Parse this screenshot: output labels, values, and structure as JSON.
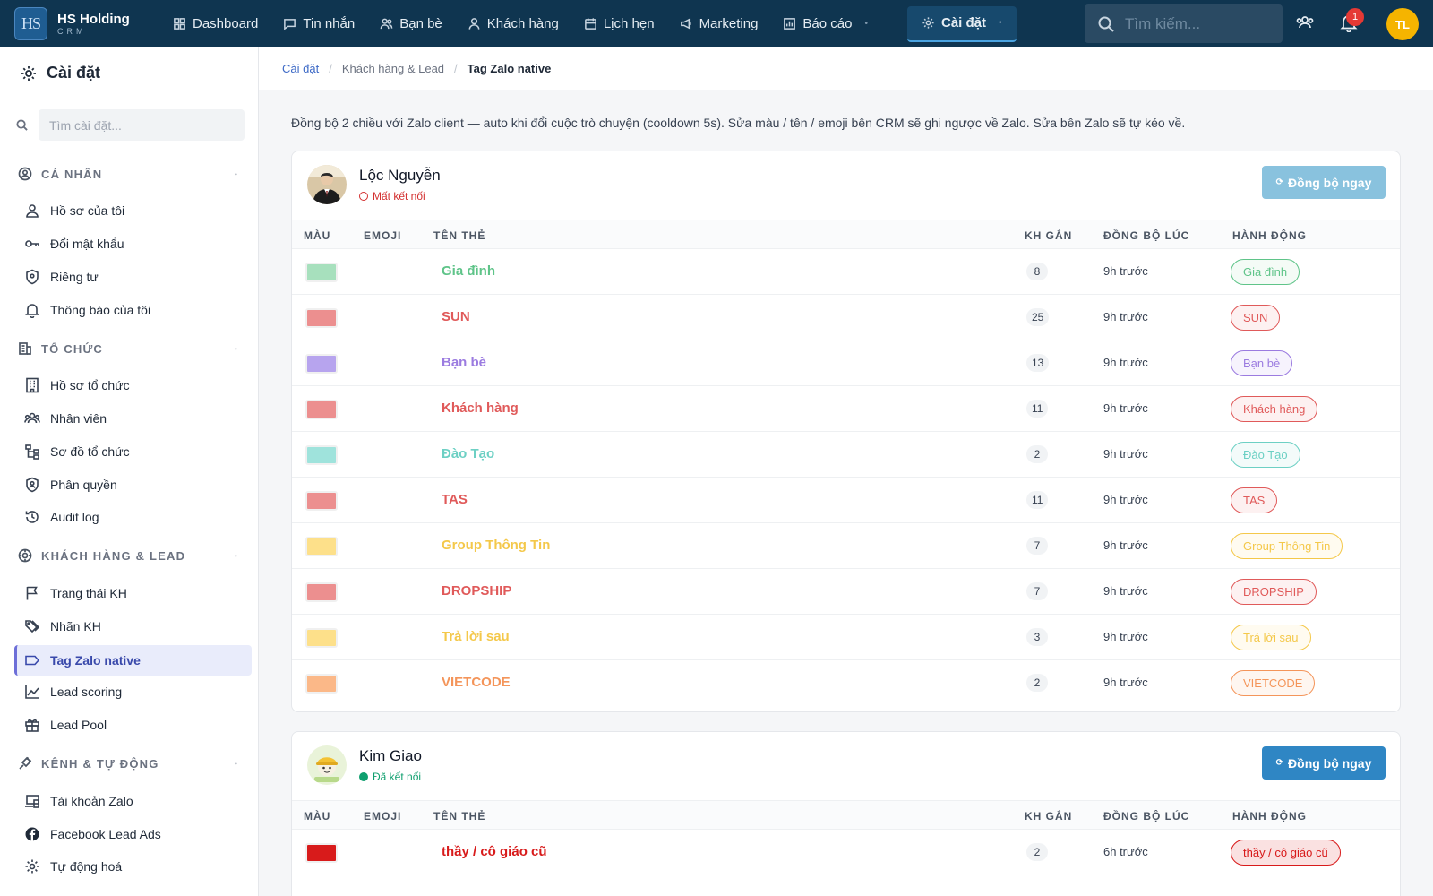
{
  "brand": {
    "logo": "HS",
    "title": "HS Holding",
    "subtitle": "CRM"
  },
  "nav": [
    {
      "label": "Dashboard",
      "icon": "grid-icon"
    },
    {
      "label": "Tin nhắn",
      "icon": "chat-icon"
    },
    {
      "label": "Bạn bè",
      "icon": "users-icon"
    },
    {
      "label": "Khách hàng",
      "icon": "user-icon"
    },
    {
      "label": "Lịch hẹn",
      "icon": "calendar-icon"
    },
    {
      "label": "Marketing",
      "icon": "megaphone-icon"
    },
    {
      "label": "Báo cáo",
      "icon": "chart-icon"
    },
    {
      "label": "Cài đặt",
      "icon": "gear-icon"
    }
  ],
  "topbar": {
    "search_placeholder": "Tìm kiếm...",
    "notification_count": "1",
    "avatar_initials": "TL"
  },
  "sidebar": {
    "title": "Cài đặt",
    "search_placeholder": "Tìm cài đặt...",
    "sections": [
      {
        "label": "CÁ NHÂN",
        "icon": "user-circle-icon",
        "items": [
          {
            "label": "Hồ sơ của tôi",
            "icon": "person-icon"
          },
          {
            "label": "Đổi mật khẩu",
            "icon": "key-icon"
          },
          {
            "label": "Riêng tư",
            "icon": "shield-icon"
          },
          {
            "label": "Thông báo của tôi",
            "icon": "bell-icon"
          }
        ]
      },
      {
        "label": "TỔ CHỨC",
        "icon": "building-icon",
        "items": [
          {
            "label": "Hồ sơ tổ chức",
            "icon": "office-icon"
          },
          {
            "label": "Nhân viên",
            "icon": "team-icon"
          },
          {
            "label": "Sơ đồ tổ chức",
            "icon": "org-chart-icon"
          },
          {
            "label": "Phân quyền",
            "icon": "shield-user-icon"
          },
          {
            "label": "Audit log",
            "icon": "history-icon"
          }
        ]
      },
      {
        "label": "KHÁCH HÀNG & LEAD",
        "icon": "target-icon",
        "items": [
          {
            "label": "Trạng thái KH",
            "icon": "flag-icon"
          },
          {
            "label": "Nhãn KH",
            "icon": "tags-icon"
          },
          {
            "label": "Tag Zalo native",
            "icon": "tag-icon"
          },
          {
            "label": "Lead scoring",
            "icon": "trend-icon"
          },
          {
            "label": "Lead Pool",
            "icon": "gift-icon"
          }
        ]
      },
      {
        "label": "KÊNH & TỰ ĐỘNG",
        "icon": "plug-icon",
        "items": [
          {
            "label": "Tài khoản Zalo",
            "icon": "devices-icon"
          },
          {
            "label": "Facebook Lead Ads",
            "icon": "facebook-icon"
          },
          {
            "label": "Tự động hoá",
            "icon": "cog-icon"
          }
        ]
      }
    ]
  },
  "breadcrumb": [
    "Cài đặt",
    "Khách hàng & Lead",
    "Tag Zalo native"
  ],
  "description": "Đồng bộ 2 chiều với Zalo client — auto khi đổi cuộc trò chuyện (cooldown 5s). Sửa màu / tên / emoji bên CRM sẽ ghi ngược về Zalo. Sửa bên Zalo sẽ tự kéo về.",
  "table_headers": [
    "MÀU",
    "EMOJI",
    "TÊN THẺ",
    "KH GẮN",
    "ĐỒNG BỘ LÚC",
    "HÀNH ĐỘNG"
  ],
  "accounts": [
    {
      "name": "Lộc Nguyễn",
      "status": "Mất kết nối",
      "status_color": "#d32f2f",
      "sync_label": "Đồng bộ ngay",
      "sync_color": "#89c2de",
      "tags": [
        {
          "name": "Gia đình",
          "color": "#a7e0bd",
          "text_color": "#5fc489",
          "count": "8",
          "synced": "9h trước"
        },
        {
          "name": "SUN",
          "color": "#ec8f8f",
          "text_color": "#e05a5a",
          "count": "25",
          "synced": "9h trước"
        },
        {
          "name": "Bạn bè",
          "color": "#b7a4ee",
          "text_color": "#9b7be0",
          "count": "13",
          "synced": "9h trước"
        },
        {
          "name": "Khách hàng",
          "color": "#ec8f8f",
          "text_color": "#e05a5a",
          "count": "11",
          "synced": "9h trước"
        },
        {
          "name": "Đào Tạo",
          "color": "#9fe3dc",
          "text_color": "#6dd0c4",
          "count": "2",
          "synced": "9h trước"
        },
        {
          "name": "TAS",
          "color": "#ec8f8f",
          "text_color": "#e05a5a",
          "count": "11",
          "synced": "9h trước"
        },
        {
          "name": "Group Thông Tin",
          "color": "#fde08a",
          "text_color": "#f4c84a",
          "count": "7",
          "synced": "9h trước"
        },
        {
          "name": "DROPSHIP",
          "color": "#ec8f8f",
          "text_color": "#e05a5a",
          "count": "7",
          "synced": "9h trước"
        },
        {
          "name": "Trả lời sau",
          "color": "#fde08a",
          "text_color": "#f4c84a",
          "count": "3",
          "synced": "9h trước"
        },
        {
          "name": "VIETCODE",
          "color": "#fbb888",
          "text_color": "#f4955a",
          "count": "2",
          "synced": "9h trước"
        }
      ]
    },
    {
      "name": "Kim Giao",
      "status": "Đã kết nối",
      "status_color": "#0e9f6e",
      "sync_label": "Đồng bộ ngay",
      "sync_color": "#2f86c4",
      "tags": [
        {
          "name": "thầy / cô giáo cũ",
          "color": "#d81b1b",
          "text_color": "#d81b1b",
          "count": "2",
          "synced": "6h trước"
        }
      ]
    }
  ]
}
